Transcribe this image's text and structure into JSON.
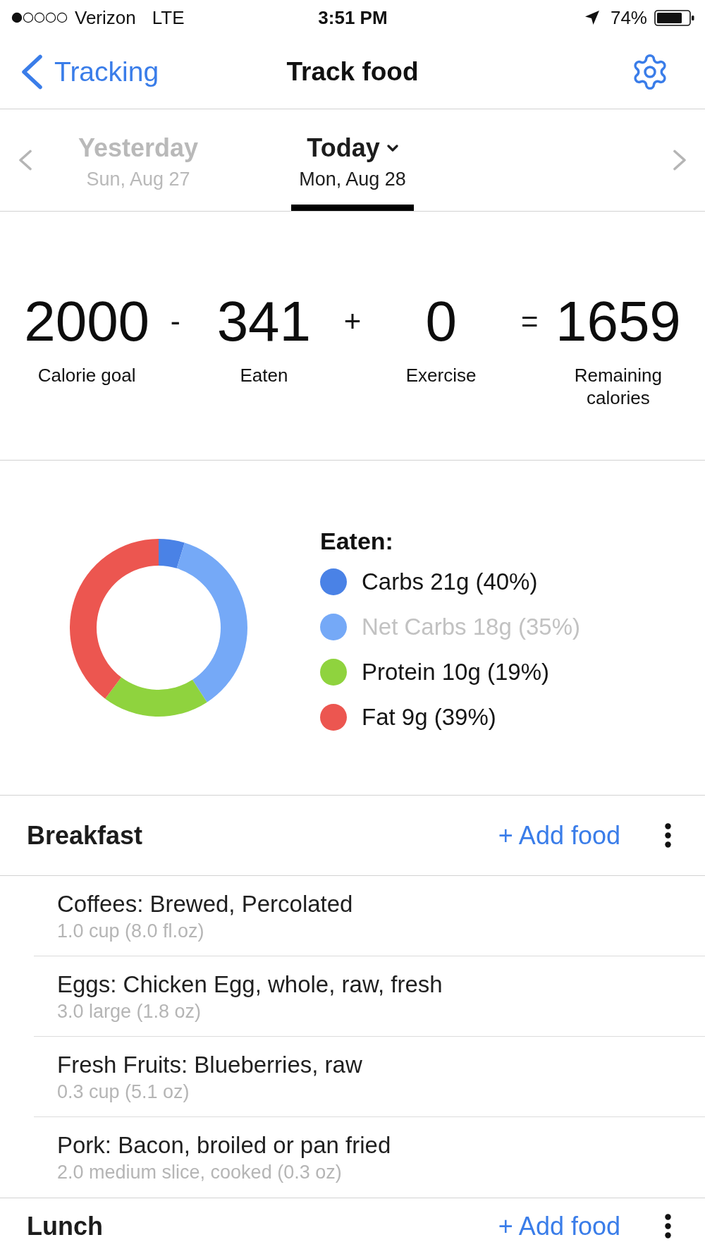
{
  "status_bar": {
    "carrier": "Verizon",
    "network": "LTE",
    "time": "3:51 PM",
    "battery": "74%"
  },
  "nav_bar": {
    "back": "Tracking",
    "title": "Track food"
  },
  "date_tabs": [
    {
      "label": "Yesterday",
      "date": "Sun, Aug 27",
      "selected": false
    },
    {
      "label": "Today",
      "date": "Mon, Aug 28",
      "selected": true
    }
  ],
  "calorie_summary": [
    {
      "value": "2000",
      "label": "Calorie goal"
    },
    {
      "operator": "-",
      "value": "341",
      "label": "Eaten"
    },
    {
      "operator": "+",
      "value": "0",
      "label": "Exercise"
    },
    {
      "operator": "=",
      "value": "1659",
      "label": "Remaining calories"
    }
  ],
  "macros": {
    "title": "Eaten:",
    "items": [
      {
        "label": "Carbs 21g (40%)",
        "color": "#4a82e6",
        "muted": false
      },
      {
        "label": "Net Carbs 18g (35%)",
        "color": "#75a9f7",
        "muted": true
      },
      {
        "label": "Protein 10g (19%)",
        "color": "#8fd33e",
        "muted": false
      },
      {
        "label": "Fat 9g (39%)",
        "color": "#ec5650",
        "muted": false
      }
    ]
  },
  "meals": [
    {
      "name": "Breakfast",
      "action": "+ Add food",
      "foods": [
        {
          "name": "Coffees: Brewed, Percolated",
          "serving": "1.0 cup (8.0 fl.oz)"
        },
        {
          "name": "Eggs: Chicken Egg, whole, raw, fresh",
          "serving": "3.0 large (1.8 oz)"
        },
        {
          "name": "Fresh Fruits: Blueberries, raw",
          "serving": "0.3 cup (5.1 oz)"
        },
        {
          "name": "Pork: Bacon, broiled or pan fried",
          "serving": "2.0 medium slice, cooked (0.3 oz)"
        }
      ]
    },
    {
      "name": "Lunch",
      "action": "+ Add food"
    }
  ]
}
